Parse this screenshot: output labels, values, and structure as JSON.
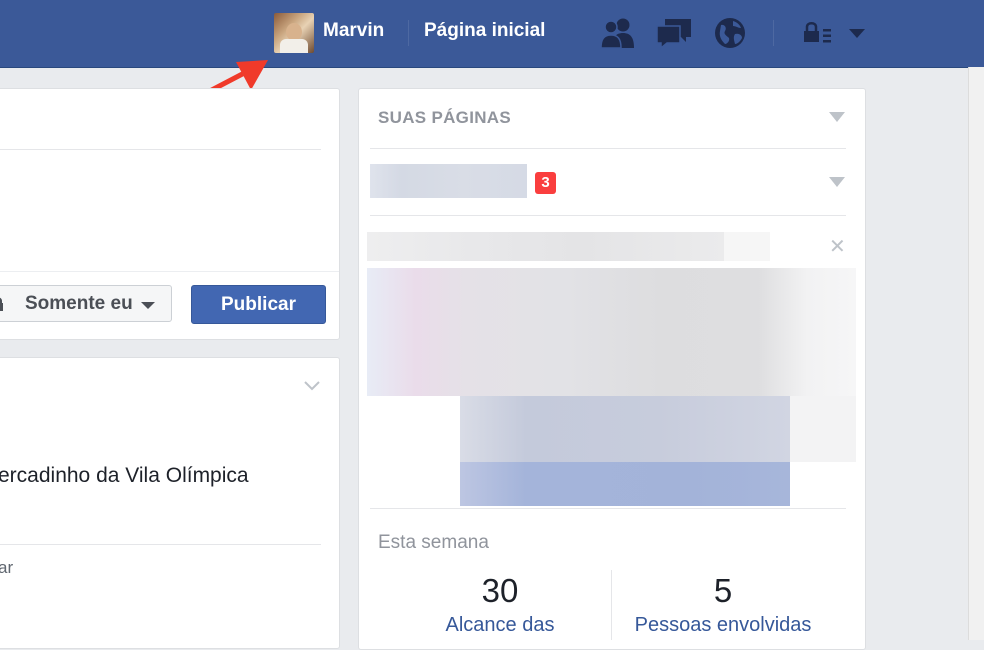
{
  "topbar": {
    "user_name": "Marvin",
    "home_label": "Página inicial",
    "icons": [
      "avatar",
      "friend-requests-icon",
      "messages-icon",
      "notifications-globe-icon",
      "quick-help-lock-icon",
      "account-menu-caret-icon"
    ]
  },
  "composer": {
    "privacy_label": "Somente eu",
    "publish_label": "Publicar"
  },
  "post": {
    "text": "ercadinho da Vila Olímpica",
    "footer_text": "ar"
  },
  "pages_panel": {
    "title": "SUAS PÁGINAS",
    "notification_count": "3",
    "this_week_label": "Esta semana",
    "stats": [
      {
        "value": "30",
        "label": "Alcance das"
      },
      {
        "value": "5",
        "label": "Pessoas envolvidas"
      }
    ]
  },
  "colors": {
    "brand_blue": "#3b5998",
    "button_blue": "#4267b2",
    "badge_red": "#fa3e3e",
    "link_blue": "#365899",
    "annotation_arrow": "#f03a2a"
  }
}
